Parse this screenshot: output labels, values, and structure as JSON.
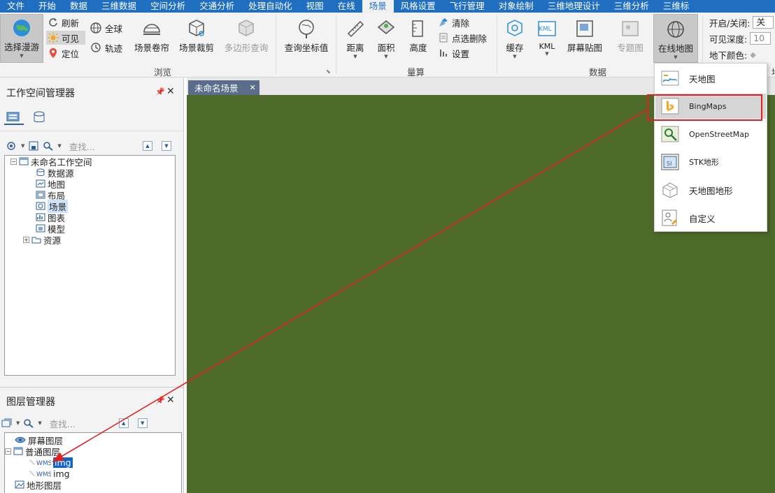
{
  "menubar": {
    "items": [
      {
        "label": "文件",
        "active": false
      },
      {
        "label": "开始",
        "active": false
      },
      {
        "label": "数据",
        "active": false
      },
      {
        "label": "三维数据",
        "active": false
      },
      {
        "label": "空间分析",
        "active": false
      },
      {
        "label": "交通分析",
        "active": false
      },
      {
        "label": "处理自动化",
        "active": false
      },
      {
        "label": "视图",
        "active": false
      },
      {
        "label": "在线",
        "active": false
      },
      {
        "label": "场景",
        "active": true
      },
      {
        "label": "风格设置",
        "active": false
      },
      {
        "label": "飞行管理",
        "active": false
      },
      {
        "label": "对象绘制",
        "active": false
      },
      {
        "label": "三维地理设计",
        "active": false
      },
      {
        "label": "三维分析",
        "active": false
      },
      {
        "label": "三维标",
        "active": false
      }
    ]
  },
  "ribbon": {
    "browse": {
      "select_roam": "选择漫游",
      "refresh": "刷新",
      "visible": "可见",
      "locate": "定位",
      "globe": "全球",
      "track": "轨迹",
      "scene_curtain": "场景卷帘",
      "scene_clip": "场景裁剪",
      "polygon_query": "多边形查询",
      "query_coord": "查询坐标值",
      "group": "浏览"
    },
    "measure": {
      "distance": "距离",
      "area": "面积",
      "height": "高度",
      "clear": "清除",
      "point_delete": "点选删除",
      "settings": "设置",
      "group": "量算"
    },
    "data": {
      "cache": "缓存",
      "kml_icon": "KML",
      "kml": "KML",
      "screen_sticker": "屏幕贴图",
      "thematic": "专题图",
      "online_map": "在线地图",
      "group": "数据"
    },
    "underground": {
      "toggle_label": "开启/关闭:",
      "toggle_value": "关",
      "depth_label": "可见深度:",
      "depth_value": "10",
      "color_label": "地下颜色:",
      "group_partial": "地"
    }
  },
  "workspace_panel": {
    "title": "工作空间管理器",
    "search_placeholder": "查找...",
    "tree": [
      {
        "label": "未命名工作空间",
        "icon": "workspace-icon",
        "state": "normal"
      },
      {
        "label": "数据源",
        "icon": "datasource-icon",
        "state": "normal"
      },
      {
        "label": "地图",
        "icon": "map-icon",
        "state": "normal"
      },
      {
        "label": "布局",
        "icon": "layout-icon",
        "state": "normal"
      },
      {
        "label": "场景",
        "icon": "scene-icon",
        "state": "highlighted"
      },
      {
        "label": "图表",
        "icon": "chart-icon",
        "state": "normal"
      },
      {
        "label": "模型",
        "icon": "model-icon",
        "state": "normal"
      },
      {
        "label": "资源",
        "icon": "resource-icon",
        "state": "normal"
      }
    ]
  },
  "layer_panel": {
    "title": "图层管理器",
    "search_placeholder": "查找...",
    "tree": [
      {
        "label": "屏幕图层",
        "icon": "eye-icon",
        "state": "normal"
      },
      {
        "label": "普通图层",
        "icon": "layer-group-icon",
        "state": "normal"
      },
      {
        "label": "img",
        "icon": "wms-icon",
        "state": "selected"
      },
      {
        "label": "img",
        "icon": "wms-icon",
        "state": "normal"
      },
      {
        "label": "地形图层",
        "icon": "terrain-layer-icon",
        "state": "normal"
      }
    ]
  },
  "document": {
    "tab_title": "未命名场景",
    "scene_color": "#4e6a2b"
  },
  "online_map_dropdown": {
    "items": [
      {
        "label": "天地图",
        "icon": "tianditu-icon",
        "hover": false
      },
      {
        "label": "BingMaps",
        "icon": "bing-icon",
        "hover": true
      },
      {
        "label": "OpenStreetMap",
        "icon": "osm-icon",
        "hover": false
      },
      {
        "label": "STK地形",
        "icon": "stk-terrain-icon",
        "hover": false
      },
      {
        "label": "天地图地形",
        "icon": "tianditu-terrain-icon",
        "hover": false
      },
      {
        "label": "自定义",
        "icon": "custom-icon",
        "hover": false
      }
    ]
  },
  "annotation": {
    "color": "#e02020"
  },
  "colors": {
    "menubar": "#1f6ebf",
    "selection": "#1164c8",
    "highlight": "#cfe3f8",
    "tab": "#5a6d8a"
  }
}
